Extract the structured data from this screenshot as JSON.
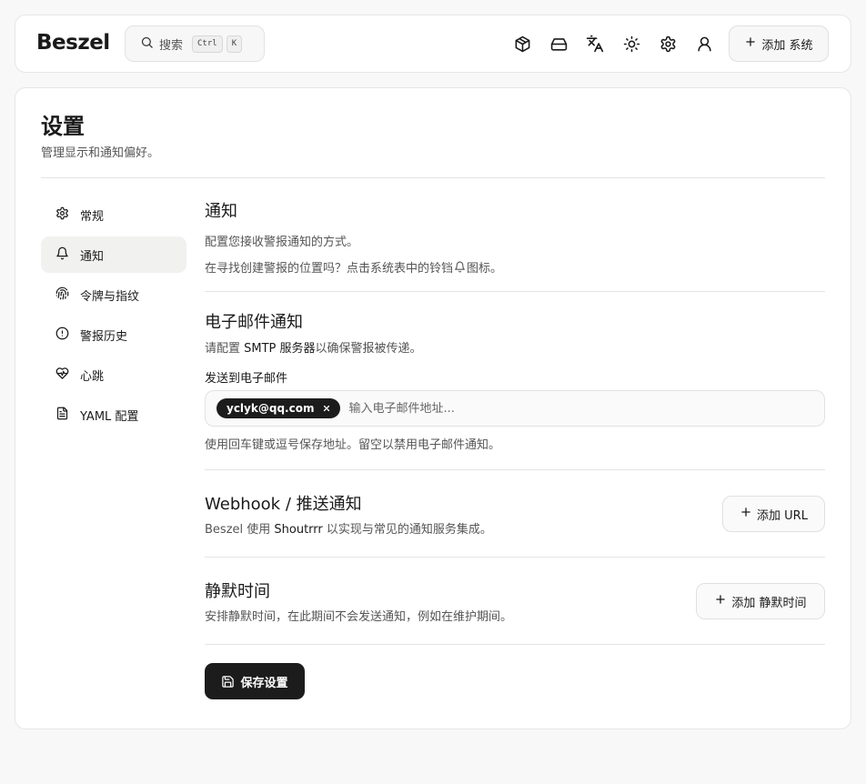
{
  "app": {
    "logo": "Beszel"
  },
  "search": {
    "label": "搜索",
    "kbd1": "Ctrl",
    "kbd2": "K"
  },
  "header": {
    "icons": [
      "box-icon",
      "hard-drive-icon",
      "language-icon",
      "sun-icon",
      "gear-icon",
      "user-icon"
    ],
    "add_system_label": "添加 系统"
  },
  "page": {
    "title": "设置",
    "subtitle": "管理显示和通知偏好。"
  },
  "sidebar": {
    "items": [
      {
        "label": "常规",
        "icon": "gear-icon"
      },
      {
        "label": "通知",
        "icon": "bell-icon",
        "active": true
      },
      {
        "label": "令牌与指纹",
        "icon": "fingerprint-icon"
      },
      {
        "label": "警报历史",
        "icon": "alert-circle-icon"
      },
      {
        "label": "心跳",
        "icon": "heart-pulse-icon"
      },
      {
        "label": "YAML 配置",
        "icon": "file-text-icon"
      }
    ]
  },
  "notifications": {
    "title": "通知",
    "desc": "配置您接收警报通知的方式。",
    "hint_prefix": "在寻找创建警报的位置吗？点击系统表中的铃铛",
    "hint_suffix": "图标。"
  },
  "email": {
    "title": "电子邮件通知",
    "desc_prefix": "请配置 ",
    "desc_link": "SMTP 服务器",
    "desc_suffix": "以确保警报被传递。",
    "field_label": "发送到电子邮件",
    "chip": "yclyk@qq.com",
    "placeholder": "输入电子邮件地址...",
    "help": "使用回车键或逗号保存地址。留空以禁用电子邮件通知。"
  },
  "webhook": {
    "title": "Webhook / 推送通知",
    "desc_prefix": "Beszel 使用 ",
    "desc_link": "Shoutrrr",
    "desc_suffix": " 以实现与常见的通知服务集成。",
    "button": "添加 URL"
  },
  "quiet": {
    "title": "静默时间",
    "desc": "安排静默时间，在此期间不会发送通知，例如在维护期间。",
    "button": "添加 静默时间"
  },
  "save": {
    "label": "保存设置"
  }
}
